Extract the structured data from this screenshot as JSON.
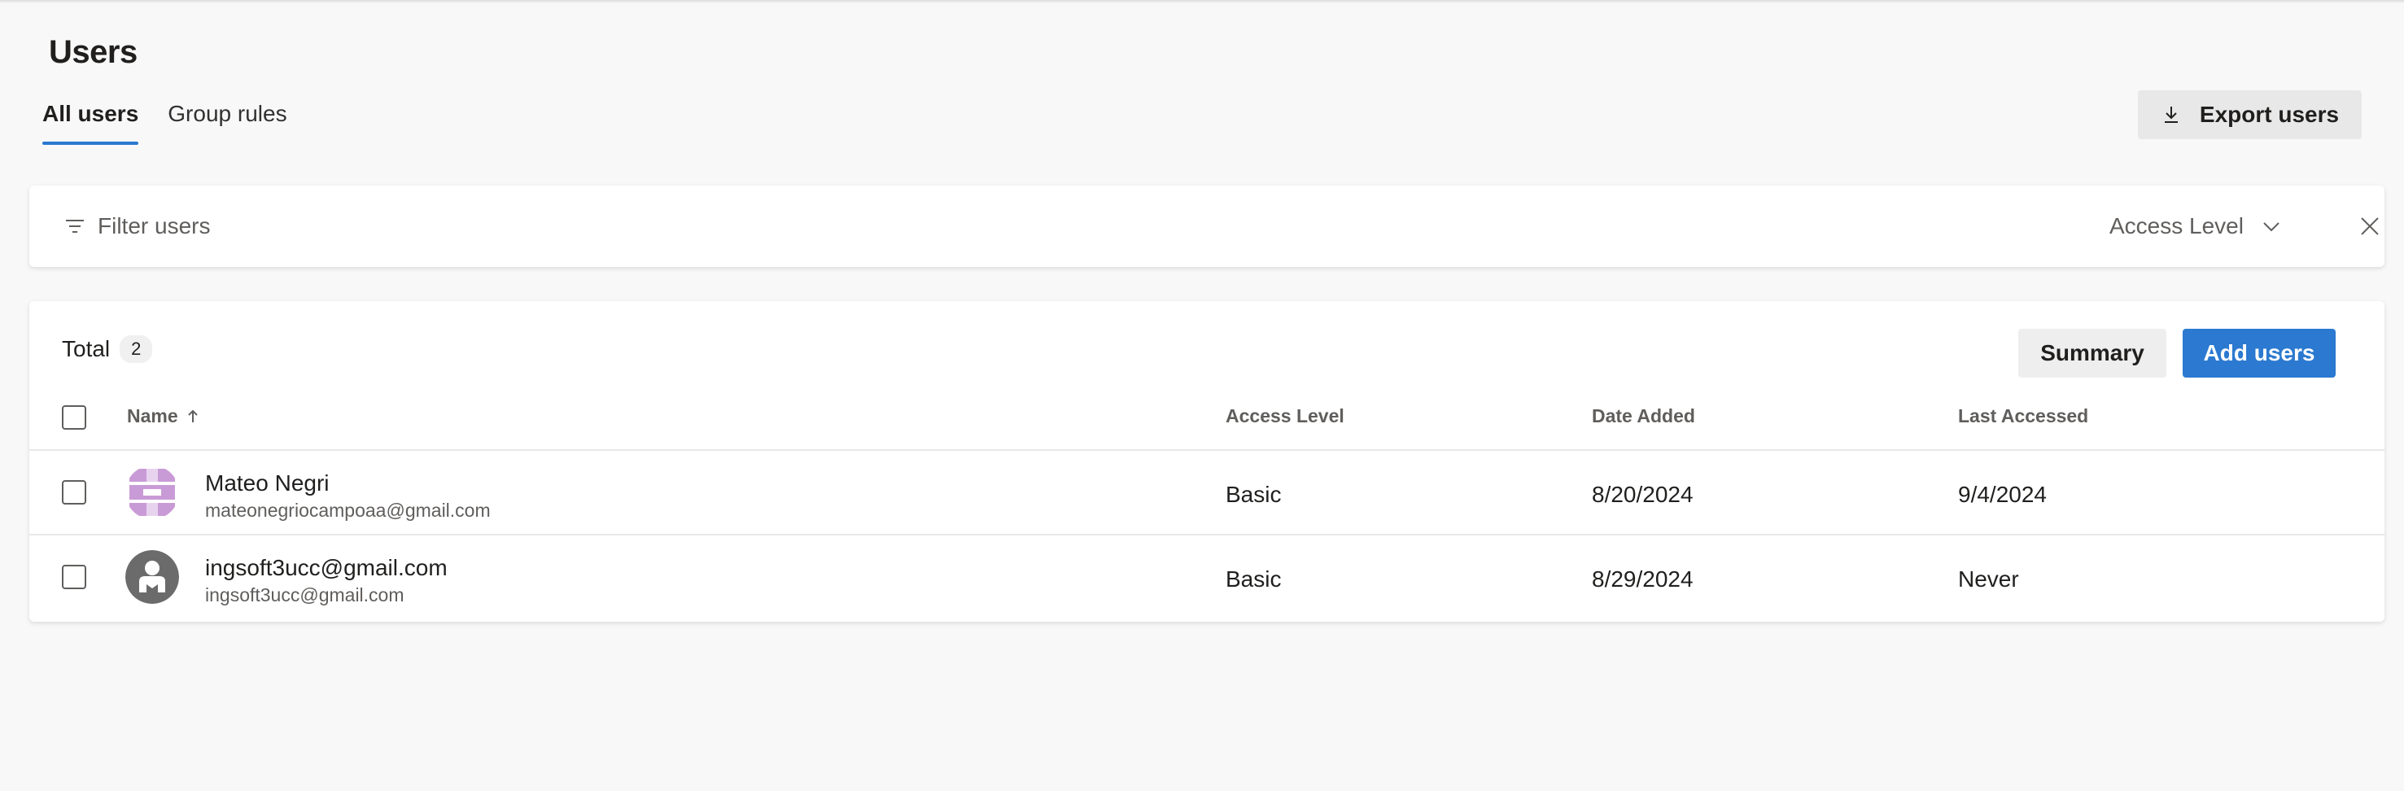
{
  "page": {
    "title": "Users"
  },
  "tabs": [
    {
      "label": "All users",
      "active": true
    },
    {
      "label": "Group rules",
      "active": false
    }
  ],
  "toolbar": {
    "export_label": "Export users"
  },
  "filter": {
    "placeholder": "Filter users",
    "access_level_label": "Access Level"
  },
  "table": {
    "total_label": "Total",
    "total_count": "2",
    "summary_label": "Summary",
    "add_label": "Add users",
    "columns": {
      "name": "Name",
      "access_level": "Access Level",
      "date_added": "Date Added",
      "last_accessed": "Last Accessed"
    },
    "rows": [
      {
        "name": "Mateo Negri",
        "email": "mateonegriocampoaa@gmail.com",
        "access_level": "Basic",
        "date_added": "8/20/2024",
        "last_accessed": "9/4/2024",
        "avatar": "identicon-avatar"
      },
      {
        "name": "ingsoft3ucc@gmail.com",
        "email": "ingsoft3ucc@gmail.com",
        "access_level": "Basic",
        "date_added": "8/29/2024",
        "last_accessed": "Never",
        "avatar": "person-avatar"
      }
    ]
  },
  "colors": {
    "accent": "#2b79d0",
    "avatar_identicon": "#c99bd6",
    "avatar_person": "#6b6b6b"
  }
}
